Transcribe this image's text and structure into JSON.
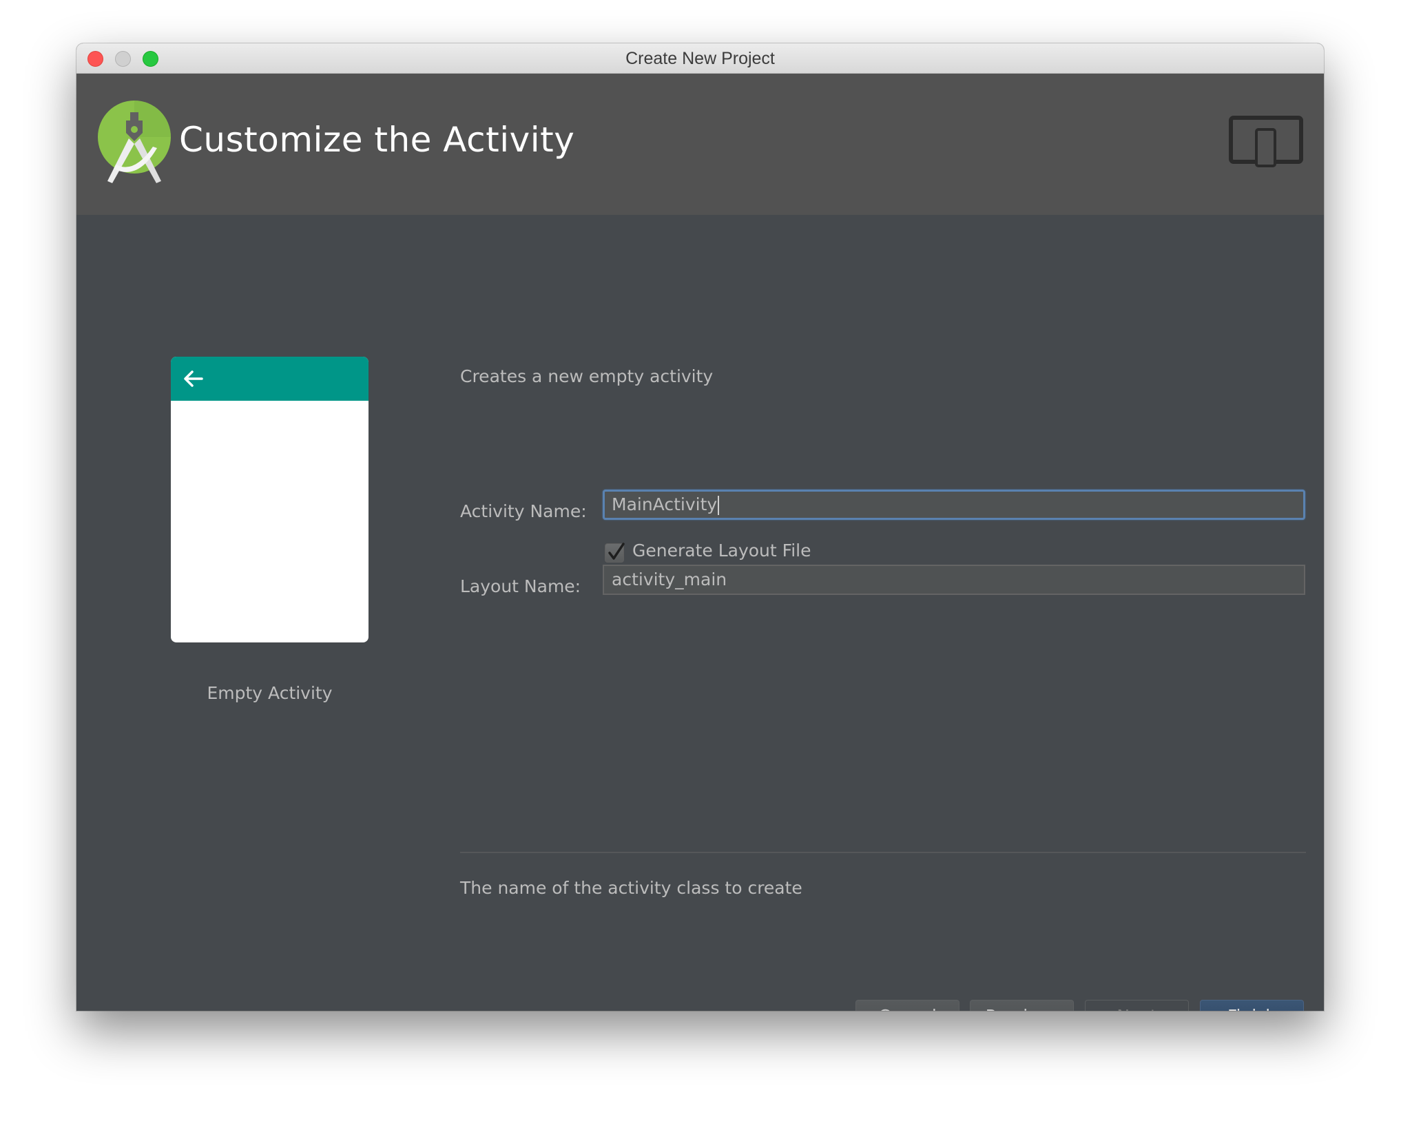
{
  "window": {
    "title": "Create New Project",
    "traffic_lights": [
      "close",
      "minimize",
      "maximize"
    ]
  },
  "header": {
    "logo_icon": "android-studio-logo-icon",
    "title": "Customize the Activity",
    "device_icon": "tablet-phone-icon"
  },
  "preview": {
    "toolbar_color": "#009688",
    "back_icon": "arrow-back-icon",
    "label": "Empty Activity"
  },
  "form": {
    "description": "Creates a new empty activity",
    "activity_name_label": "Activity Name:",
    "activity_name_value": "MainActivity",
    "generate_layout_label": "Generate Layout File",
    "generate_layout_checked": true,
    "layout_name_label": "Layout Name:",
    "layout_name_value": "activity_main",
    "help_text": "The name of the activity class to create"
  },
  "buttons": {
    "cancel": "Cancel",
    "previous": "Previous",
    "next": "Next",
    "next_enabled": false,
    "finish": "Finish"
  },
  "colors": {
    "accent_focus": "#5a82b0",
    "primary_button": "#2e4461",
    "android_green": "#8bc34a"
  }
}
